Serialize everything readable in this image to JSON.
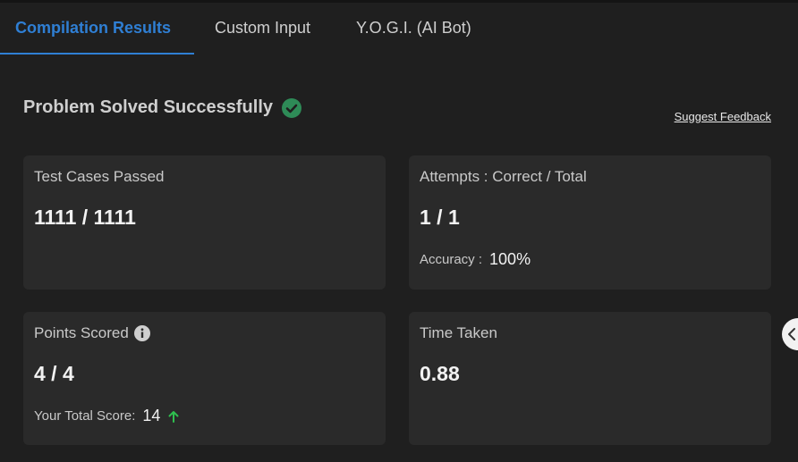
{
  "tabs": [
    {
      "label": "Compilation Results",
      "active": true
    },
    {
      "label": "Custom Input",
      "active": false
    },
    {
      "label": "Y.O.G.I. (AI Bot)",
      "active": false
    }
  ],
  "status": {
    "title": "Problem Solved Successfully",
    "icon": "check-circle-icon",
    "icon_color": "#2e8b57"
  },
  "feedback": {
    "label": "Suggest Feedback"
  },
  "cards": {
    "test_cases": {
      "label": "Test Cases Passed",
      "value": "1111 / 1111"
    },
    "attempts": {
      "label": "Attempts : Correct / Total",
      "value": "1 / 1",
      "sub_label": "Accuracy :",
      "sub_value": "100%"
    },
    "points": {
      "label": "Points Scored",
      "value": "4 / 4",
      "sub_label": "Your Total Score:",
      "sub_value": "14",
      "info_icon": "info-icon",
      "trend_icon": "arrow-up-icon",
      "trend_color": "#2fbf4f"
    },
    "time": {
      "label": "Time Taken",
      "value": "0.88"
    }
  },
  "colors": {
    "accent": "#2f7fd4",
    "background": "#1f1f1f",
    "card": "#2a2a2a"
  }
}
